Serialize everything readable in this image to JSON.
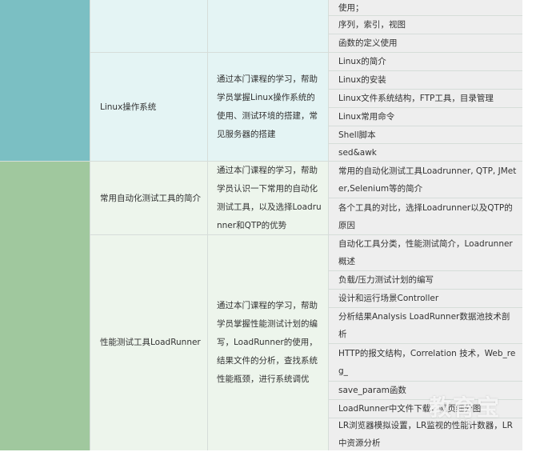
{
  "colors": {
    "category_linux": "#7bbfc3",
    "category_testing": "#a0c89e",
    "row_linux": "#e4f4f4",
    "row_testing": "#edf5ec",
    "grid": "#d6ddd9",
    "text": "#333333"
  },
  "rows": [
    {
      "course": "",
      "description": "",
      "topics": [
        "使用；",
        "序列，索引，视图",
        "函数的定义使用"
      ]
    },
    {
      "course": "Linux操作系统",
      "description": "通过本门课程的学习，帮助学员掌握Linux操作系统的使用、测试环境的搭建，常见服务器的搭建",
      "topics": [
        "Linux的简介",
        "Linux的安装",
        "Linux文件系统结构，FTP工具，目录管理",
        "Linux常用命令",
        "Shell脚本",
        "sed&awk"
      ]
    },
    {
      "course": "常用自动化测试工具的简介",
      "description": "通过本门课程的学习，帮助学员认识一下常用的自动化测试工具，以及选择Loadrunner和QTP的优势",
      "topics": [
        "常用的自动化测试工具Loadrunner, QTP, JMeter,Selenium等的简介",
        "各个工具的对比，选择Loadrunner以及QTP的原因"
      ]
    },
    {
      "course": "性能测试工具LoadRunner",
      "description": "通过本门课程的学习，帮助学员掌握性能测试计划的编写，LoadRunner的使用，结果文件的分析，查找系统性能瓶颈，进行系统调优",
      "topics": [
        "自动化工具分类，性能测试简介，Loadrunner概述",
        "负载/压力测试计划的编写",
        "设计和运行场景Controller",
        "分析结果Analysis LoadRunner数据池技术剖析",
        "HTTP的报文结构，Correlation 技术，Web_reg_",
        "save_param函数",
        "LoadRunner中文件下载，网页细分图",
        "LR浏览器模拟设置，LR监视的性能计数器，LR中资源分析"
      ]
    }
  ],
  "watermark": {
    "text": "教育宝",
    "sub": ".CO"
  }
}
